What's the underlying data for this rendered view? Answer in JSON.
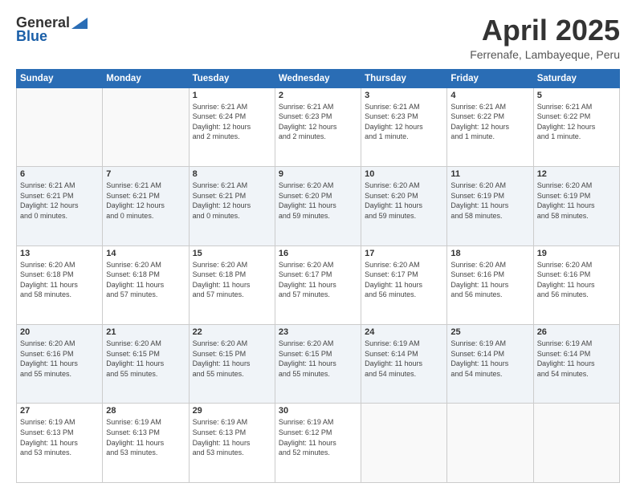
{
  "logo": {
    "general": "General",
    "blue": "Blue"
  },
  "title": "April 2025",
  "location": "Ferrenafe, Lambayeque, Peru",
  "days_header": [
    "Sunday",
    "Monday",
    "Tuesday",
    "Wednesday",
    "Thursday",
    "Friday",
    "Saturday"
  ],
  "weeks": [
    [
      {
        "day": "",
        "info": ""
      },
      {
        "day": "",
        "info": ""
      },
      {
        "day": "1",
        "info": "Sunrise: 6:21 AM\nSunset: 6:24 PM\nDaylight: 12 hours\nand 2 minutes."
      },
      {
        "day": "2",
        "info": "Sunrise: 6:21 AM\nSunset: 6:23 PM\nDaylight: 12 hours\nand 2 minutes."
      },
      {
        "day": "3",
        "info": "Sunrise: 6:21 AM\nSunset: 6:23 PM\nDaylight: 12 hours\nand 1 minute."
      },
      {
        "day": "4",
        "info": "Sunrise: 6:21 AM\nSunset: 6:22 PM\nDaylight: 12 hours\nand 1 minute."
      },
      {
        "day": "5",
        "info": "Sunrise: 6:21 AM\nSunset: 6:22 PM\nDaylight: 12 hours\nand 1 minute."
      }
    ],
    [
      {
        "day": "6",
        "info": "Sunrise: 6:21 AM\nSunset: 6:21 PM\nDaylight: 12 hours\nand 0 minutes."
      },
      {
        "day": "7",
        "info": "Sunrise: 6:21 AM\nSunset: 6:21 PM\nDaylight: 12 hours\nand 0 minutes."
      },
      {
        "day": "8",
        "info": "Sunrise: 6:21 AM\nSunset: 6:21 PM\nDaylight: 12 hours\nand 0 minutes."
      },
      {
        "day": "9",
        "info": "Sunrise: 6:20 AM\nSunset: 6:20 PM\nDaylight: 11 hours\nand 59 minutes."
      },
      {
        "day": "10",
        "info": "Sunrise: 6:20 AM\nSunset: 6:20 PM\nDaylight: 11 hours\nand 59 minutes."
      },
      {
        "day": "11",
        "info": "Sunrise: 6:20 AM\nSunset: 6:19 PM\nDaylight: 11 hours\nand 58 minutes."
      },
      {
        "day": "12",
        "info": "Sunrise: 6:20 AM\nSunset: 6:19 PM\nDaylight: 11 hours\nand 58 minutes."
      }
    ],
    [
      {
        "day": "13",
        "info": "Sunrise: 6:20 AM\nSunset: 6:18 PM\nDaylight: 11 hours\nand 58 minutes."
      },
      {
        "day": "14",
        "info": "Sunrise: 6:20 AM\nSunset: 6:18 PM\nDaylight: 11 hours\nand 57 minutes."
      },
      {
        "day": "15",
        "info": "Sunrise: 6:20 AM\nSunset: 6:18 PM\nDaylight: 11 hours\nand 57 minutes."
      },
      {
        "day": "16",
        "info": "Sunrise: 6:20 AM\nSunset: 6:17 PM\nDaylight: 11 hours\nand 57 minutes."
      },
      {
        "day": "17",
        "info": "Sunrise: 6:20 AM\nSunset: 6:17 PM\nDaylight: 11 hours\nand 56 minutes."
      },
      {
        "day": "18",
        "info": "Sunrise: 6:20 AM\nSunset: 6:16 PM\nDaylight: 11 hours\nand 56 minutes."
      },
      {
        "day": "19",
        "info": "Sunrise: 6:20 AM\nSunset: 6:16 PM\nDaylight: 11 hours\nand 56 minutes."
      }
    ],
    [
      {
        "day": "20",
        "info": "Sunrise: 6:20 AM\nSunset: 6:16 PM\nDaylight: 11 hours\nand 55 minutes."
      },
      {
        "day": "21",
        "info": "Sunrise: 6:20 AM\nSunset: 6:15 PM\nDaylight: 11 hours\nand 55 minutes."
      },
      {
        "day": "22",
        "info": "Sunrise: 6:20 AM\nSunset: 6:15 PM\nDaylight: 11 hours\nand 55 minutes."
      },
      {
        "day": "23",
        "info": "Sunrise: 6:20 AM\nSunset: 6:15 PM\nDaylight: 11 hours\nand 55 minutes."
      },
      {
        "day": "24",
        "info": "Sunrise: 6:19 AM\nSunset: 6:14 PM\nDaylight: 11 hours\nand 54 minutes."
      },
      {
        "day": "25",
        "info": "Sunrise: 6:19 AM\nSunset: 6:14 PM\nDaylight: 11 hours\nand 54 minutes."
      },
      {
        "day": "26",
        "info": "Sunrise: 6:19 AM\nSunset: 6:14 PM\nDaylight: 11 hours\nand 54 minutes."
      }
    ],
    [
      {
        "day": "27",
        "info": "Sunrise: 6:19 AM\nSunset: 6:13 PM\nDaylight: 11 hours\nand 53 minutes."
      },
      {
        "day": "28",
        "info": "Sunrise: 6:19 AM\nSunset: 6:13 PM\nDaylight: 11 hours\nand 53 minutes."
      },
      {
        "day": "29",
        "info": "Sunrise: 6:19 AM\nSunset: 6:13 PM\nDaylight: 11 hours\nand 53 minutes."
      },
      {
        "day": "30",
        "info": "Sunrise: 6:19 AM\nSunset: 6:12 PM\nDaylight: 11 hours\nand 52 minutes."
      },
      {
        "day": "",
        "info": ""
      },
      {
        "day": "",
        "info": ""
      },
      {
        "day": "",
        "info": ""
      }
    ]
  ]
}
